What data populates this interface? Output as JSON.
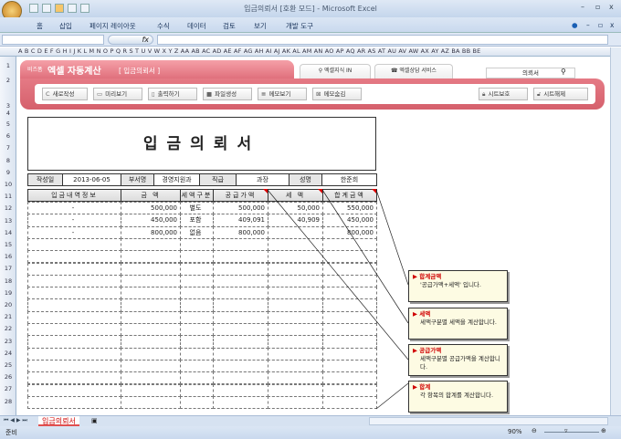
{
  "window": {
    "title": "입금의뢰서  [호환 모드] - Microsoft Excel"
  },
  "ribbon_tabs": [
    "홈",
    "삽입",
    "페이지 레이아웃",
    "수식",
    "데이터",
    "검토",
    "보기",
    "개발 도구"
  ],
  "formula_bar": {
    "fx": "fx",
    "value": ""
  },
  "columns": "A B C D E F G H I J K L M N O P Q R S T U V W X Y Z AA AB AC AD AE AF AG AH AI AJ AK AL AM AN AO AP AQ AR AS AT AU AV AW AX AY AZ BA BB BE",
  "rows": [
    "1",
    "2",
    "3",
    "4",
    "5",
    "6",
    "7",
    "8",
    "9",
    "10",
    "11",
    "12",
    "13",
    "14",
    "15",
    "16",
    "17",
    "18",
    "19",
    "20",
    "21",
    "22",
    "23",
    "24",
    "25",
    "26",
    "27",
    "28"
  ],
  "banner": {
    "brand_small": "비즈폼",
    "brand": "엑셀 자동계산",
    "subtitle": "[ 입금의뢰서 ]",
    "tab1": "엑셀지식 IN",
    "tab2": "엑셀상담 서비스",
    "search": "의뢰서",
    "buttons": [
      "새로작성",
      "미리보기",
      "출력하기",
      "파일생성",
      "메모보기",
      "메모숨김"
    ],
    "protect": "시트보호",
    "unprotect": "시트해제"
  },
  "doc": {
    "title": "입금의뢰서",
    "info": {
      "date_label": "작성일",
      "date": "2013-06-05",
      "dept_label": "부서명",
      "dept": "경영지원과",
      "rank_label": "직급",
      "rank": "과장",
      "name_label": "성명",
      "name": "한준희"
    },
    "headers": [
      "입금내역정보",
      "금  액",
      "세액구분",
      "공급가액",
      "세  액",
      "합계금액"
    ],
    "rows": [
      [
        "-",
        "500,000",
        "별도",
        "500,000",
        "50,000",
        "550,000"
      ],
      [
        "-",
        "450,000",
        "포함",
        "409,091",
        "40,909",
        "450,000"
      ],
      [
        "-",
        "800,000",
        "없음",
        "800,000",
        "",
        "800,000"
      ]
    ]
  },
  "callouts": [
    {
      "title": "합계금액",
      "text": "'공급가액+세액' 입니다."
    },
    {
      "title": "세액",
      "text": "세액구분별 세액을 계산합니다."
    },
    {
      "title": "공급가액",
      "text": "세액구분별 공급가액을 계산합니다."
    },
    {
      "title": "합계",
      "text": "각 항목의 합계를 계산합니다."
    }
  ],
  "sheet_tab": "입금의뢰서",
  "status": {
    "ready": "준비",
    "zoom": "90%"
  }
}
